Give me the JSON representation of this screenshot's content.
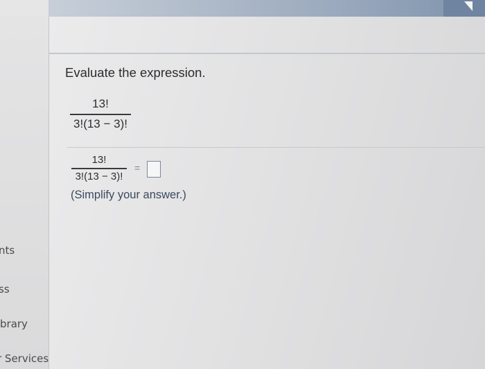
{
  "question": {
    "instruction": "Evaluate the expression.",
    "expression": {
      "numerator": "13!",
      "denominator": "3!(13 − 3)!"
    },
    "answer_line": {
      "numerator": "13!",
      "denominator": "3!(13 − 3)!",
      "equals": "=",
      "answer_value": ""
    },
    "hint": "(Simplify your answer.)"
  },
  "left_nav": {
    "items": [
      {
        "label": "nts"
      },
      {
        "label": "ss"
      },
      {
        "label": "brary"
      },
      {
        "label": "r Services"
      }
    ]
  },
  "colors": {
    "top_banner": "#7f93ad",
    "hint_text": "#3b4a5e",
    "answer_box_border": "#7d8796"
  }
}
